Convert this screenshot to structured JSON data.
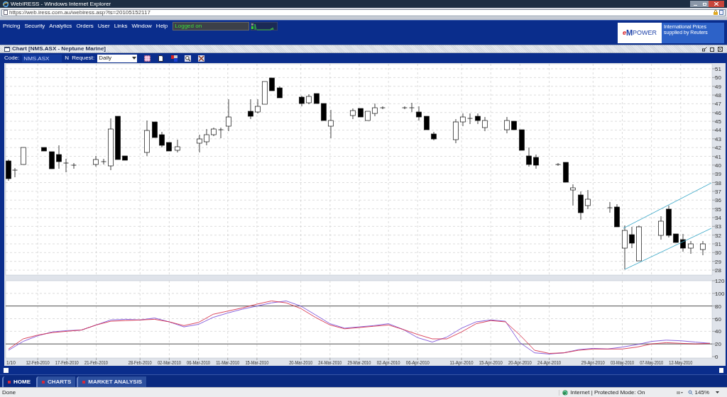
{
  "window": {
    "title": "WebIRESS - Windows Internet Explorer"
  },
  "address_bar": {
    "url": "https://web.iress.com.au/webiress.asp?ts=20105152117"
  },
  "menu": [
    "Pricing",
    "Security",
    "Analytics",
    "Orders",
    "User",
    "Links",
    "Window",
    "Help"
  ],
  "login_status": "Logged on",
  "logo": {
    "parts": [
      "e",
      "M",
      "POWER"
    ],
    "caption": "International Prices supplied by Reuters"
  },
  "chart_window": {
    "title": "Chart [NMS.ASX - Neptune Marine]"
  },
  "toolbar": {
    "code_label": "Code:",
    "code": "NMS.ASX",
    "n_label": "N",
    "request_label": "Request:",
    "request": "Daily"
  },
  "price_axis": {
    "labels": [
      "51",
      "50",
      "49",
      "48",
      "47",
      "46",
      "45",
      "44",
      "43",
      "42",
      "41",
      "40",
      "39",
      "38",
      "37",
      "36",
      "35",
      "34",
      "33",
      "32",
      "31",
      "30",
      "29",
      "28"
    ]
  },
  "oscillator": {
    "chart_data": {
      "type": "line",
      "categories": [
        null,
        null,
        "12-Feb-2010",
        null,
        "17-Feb-2010",
        null,
        "21-Feb-2010",
        null,
        null,
        "28-Feb-2010",
        null,
        "02-Mar-2010",
        null,
        "06-Mar-2010",
        null,
        "11-Mar-2010",
        null,
        "15-Mar-2010",
        null,
        null,
        "20-Mar-2010",
        null,
        "24-Mar-2010",
        null,
        "29-Mar-2010",
        null,
        "02-Apr-2010",
        null,
        "06-Apr-2010",
        null,
        null,
        "11-Apr-2010",
        null,
        "15-Apr-2010",
        null,
        "20-Apr-2010",
        null,
        "24-Apr-2010",
        null,
        null,
        "29-Apr-2010",
        null,
        "03-May-2010",
        null,
        "07-May-2010",
        null,
        "12-May-2010",
        null,
        null
      ],
      "series": [
        {
          "color": "#7a4fd8",
          "values": [
            10,
            24,
            33,
            39,
            41,
            42,
            50,
            58,
            59,
            58,
            61,
            55,
            47,
            51,
            62,
            69,
            75,
            80,
            85,
            88,
            80,
            66,
            52,
            45,
            47,
            49,
            52,
            43,
            30,
            23,
            31,
            45,
            55,
            58,
            56,
            22,
            6,
            4,
            6,
            11,
            13,
            12,
            15,
            19,
            24,
            26,
            25,
            23,
            21
          ]
        },
        {
          "color": "#d6304a",
          "values": [
            12,
            28,
            34,
            38,
            40,
            42,
            50,
            56,
            57,
            58,
            59,
            55,
            49,
            54,
            67,
            72,
            77,
            83,
            88,
            85,
            76,
            62,
            50,
            44,
            46,
            48,
            50,
            43,
            35,
            28,
            28,
            39,
            52,
            57,
            55,
            34,
            10,
            5,
            6,
            10,
            12,
            12,
            12,
            15,
            20,
            22,
            21,
            20,
            21
          ]
        }
      ],
      "ylim": [
        0,
        120
      ],
      "yticks": [
        0,
        20,
        40,
        60,
        80,
        100,
        120
      ],
      "grid": true
    }
  },
  "cut_axis_label": "1/10",
  "tabs": [
    {
      "label": "HOME",
      "selected": true
    },
    {
      "label": "CHARTS",
      "selected": false
    },
    {
      "label": "MARKET ANALYSIS",
      "selected": false
    }
  ],
  "status_bar": {
    "text": "Done",
    "zone": "Internet | Protected Mode: On",
    "zoom": "145%"
  }
}
